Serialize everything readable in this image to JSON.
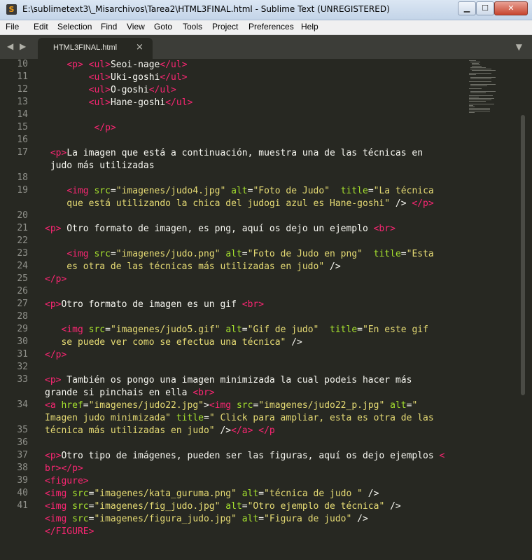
{
  "window": {
    "title": "E:\\sublimetext3\\_Misarchivos\\Tarea2\\HTML3FINAL.html - Sublime Text (UNREGISTERED)",
    "app_icon_letter": "S",
    "buttons": {
      "minimize": "▁",
      "maximize": "☐",
      "close": "✕"
    }
  },
  "menu": [
    "File",
    "Edit",
    "Selection",
    "Find",
    "View",
    "Goto",
    "Tools",
    "Project",
    "Preferences",
    "Help"
  ],
  "tabs": [
    {
      "label": "HTML3FINAL.html",
      "active": true,
      "close": "×"
    }
  ],
  "nav": {
    "back": "◀",
    "forward": "▶",
    "dropdown": "▼"
  },
  "line_numbers": [
    "10",
    "11",
    "12",
    "13",
    "14",
    "15",
    "16",
    "17",
    "18",
    "19",
    "20",
    "21",
    "22",
    "23",
    "24",
    "25",
    "26",
    "27",
    "28",
    "29",
    "30",
    "31",
    "32",
    "33",
    "34",
    "35",
    "36",
    "37",
    "38",
    "39",
    "40",
    "41"
  ],
  "code_lines": [
    [
      [
        "plain",
        "    "
      ],
      [
        "tag",
        "<p>"
      ],
      [
        "plain",
        " "
      ],
      [
        "tag",
        "<ul>"
      ],
      [
        "plain",
        "Seoi-nage"
      ],
      [
        "tag",
        "</ul>"
      ]
    ],
    [
      [
        "plain",
        "        "
      ],
      [
        "tag",
        "<ul>"
      ],
      [
        "plain",
        "Uki-goshi"
      ],
      [
        "tag",
        "</ul>"
      ]
    ],
    [
      [
        "plain",
        "        "
      ],
      [
        "tag",
        "<ul>"
      ],
      [
        "plain",
        "O-goshi"
      ],
      [
        "tag",
        "</ul>"
      ]
    ],
    [
      [
        "plain",
        "        "
      ],
      [
        "tag",
        "<ul>"
      ],
      [
        "plain",
        "Hane-goshi"
      ],
      [
        "tag",
        "</ul>"
      ]
    ],
    [],
    [
      [
        "plain",
        "         "
      ],
      [
        "tag",
        "</p>"
      ]
    ],
    [],
    [
      [
        "plain",
        " "
      ],
      [
        "tag",
        "<p>"
      ],
      [
        "plain",
        "La imagen que está a continuación, muestra una de las técnicas en"
      ]
    ],
    [
      [
        "plain",
        " judo más utilizadas"
      ]
    ],
    [],
    [
      [
        "plain",
        "    "
      ],
      [
        "tag",
        "<img"
      ],
      [
        "plain",
        " "
      ],
      [
        "attr",
        "src"
      ],
      [
        "plain",
        "="
      ],
      [
        "str",
        "\"imagenes/judo4.jpg\""
      ],
      [
        "plain",
        " "
      ],
      [
        "attr",
        "alt"
      ],
      [
        "plain",
        "="
      ],
      [
        "str",
        "\"Foto de Judo\""
      ],
      [
        "plain",
        "  "
      ],
      [
        "attr",
        "title"
      ],
      [
        "plain",
        "="
      ],
      [
        "str",
        "\"La técnica"
      ]
    ],
    [
      [
        "str",
        "    que está utilizando la chica del judogi azul es Hane-goshi\""
      ],
      [
        "plain",
        " /> "
      ],
      [
        "tag",
        "</p>"
      ]
    ],
    [],
    [
      [
        "tag",
        "<p>"
      ],
      [
        "plain",
        " Otro formato de imagen, es png, aquí os dejo un ejemplo "
      ],
      [
        "tag",
        "<br>"
      ]
    ],
    [],
    [
      [
        "plain",
        "    "
      ],
      [
        "tag",
        "<img"
      ],
      [
        "plain",
        " "
      ],
      [
        "attr",
        "src"
      ],
      [
        "plain",
        "="
      ],
      [
        "str",
        "\"imagenes/judo.png\""
      ],
      [
        "plain",
        " "
      ],
      [
        "attr",
        "alt"
      ],
      [
        "plain",
        "="
      ],
      [
        "str",
        "\"Foto de Judo en png\""
      ],
      [
        "plain",
        "  "
      ],
      [
        "attr",
        "title"
      ],
      [
        "plain",
        "="
      ],
      [
        "str",
        "\"Esta"
      ]
    ],
    [
      [
        "str",
        "    es otra de las técnicas más utilizadas en judo\""
      ],
      [
        "plain",
        " />"
      ]
    ],
    [
      [
        "tag",
        "</p>"
      ]
    ],
    [],
    [
      [
        "tag",
        "<p>"
      ],
      [
        "plain",
        "Otro formato de imagen es un gif "
      ],
      [
        "tag",
        "<br>"
      ]
    ],
    [],
    [
      [
        "plain",
        "   "
      ],
      [
        "tag",
        "<img"
      ],
      [
        "plain",
        " "
      ],
      [
        "attr",
        "src"
      ],
      [
        "plain",
        "="
      ],
      [
        "str",
        "\"imagenes/judo5.gif\""
      ],
      [
        "plain",
        " "
      ],
      [
        "attr",
        "alt"
      ],
      [
        "plain",
        "="
      ],
      [
        "str",
        "\"Gif de judo\""
      ],
      [
        "plain",
        "  "
      ],
      [
        "attr",
        "title"
      ],
      [
        "plain",
        "="
      ],
      [
        "str",
        "\"En este gif"
      ]
    ],
    [
      [
        "str",
        "   se puede ver como se efectua una técnica\""
      ],
      [
        "plain",
        " />"
      ]
    ],
    [
      [
        "tag",
        "</p>"
      ]
    ],
    [],
    [
      [
        "tag",
        "<p>"
      ],
      [
        "plain",
        " También os pongo una imagen minimizada la cual podeis hacer más"
      ]
    ],
    [
      [
        "plain",
        "grande si pinchais en ella "
      ],
      [
        "tag",
        "<br>"
      ]
    ],
    [
      [
        "tag",
        "<a"
      ],
      [
        "plain",
        " "
      ],
      [
        "attr",
        "href"
      ],
      [
        "plain",
        "="
      ],
      [
        "str",
        "\"imagenes/judo22.jpg\""
      ],
      [
        "plain",
        ">"
      ],
      [
        "tag",
        "<img"
      ],
      [
        "plain",
        " "
      ],
      [
        "attr",
        "src"
      ],
      [
        "plain",
        "="
      ],
      [
        "str",
        "\"imagenes/judo22_p.jpg\""
      ],
      [
        "plain",
        " "
      ],
      [
        "attr",
        "alt"
      ],
      [
        "plain",
        "="
      ],
      [
        "str",
        "\""
      ]
    ],
    [
      [
        "str",
        "Imagen judo minimizada\""
      ],
      [
        "plain",
        " "
      ],
      [
        "attr",
        "title"
      ],
      [
        "plain",
        "="
      ],
      [
        "str",
        "\" Click para ampliar, esta es otra de las"
      ]
    ],
    [
      [
        "str",
        "técnica más utilizadas en judo\""
      ],
      [
        "plain",
        " />"
      ],
      [
        "tag",
        "</a>"
      ],
      [
        "plain",
        " "
      ],
      [
        "tag",
        "</p"
      ]
    ],
    [],
    [
      [
        "tag",
        "<p>"
      ],
      [
        "plain",
        "Otro tipo de imágenes, pueden ser las figuras, aquí os dejo ejemplos "
      ],
      [
        "tag",
        "<"
      ]
    ],
    [
      [
        "tag",
        "br></p>"
      ]
    ],
    [
      [
        "tag",
        "<figure>"
      ]
    ],
    [
      [
        "tag",
        "<img"
      ],
      [
        "plain",
        " "
      ],
      [
        "attr",
        "src"
      ],
      [
        "plain",
        "="
      ],
      [
        "str",
        "\"imagenes/kata_guruma.png\""
      ],
      [
        "plain",
        " "
      ],
      [
        "attr",
        "alt"
      ],
      [
        "plain",
        "="
      ],
      [
        "str",
        "\"técnica de judo \""
      ],
      [
        "plain",
        " />"
      ]
    ],
    [
      [
        "tag",
        "<img"
      ],
      [
        "plain",
        " "
      ],
      [
        "attr",
        "src"
      ],
      [
        "plain",
        "="
      ],
      [
        "str",
        "\"imagenes/fig_judo.jpg\""
      ],
      [
        "plain",
        " "
      ],
      [
        "attr",
        "alt"
      ],
      [
        "plain",
        "="
      ],
      [
        "str",
        "\"Otro ejemplo de técnica\""
      ],
      [
        "plain",
        " />"
      ]
    ],
    [
      [
        "tag",
        "<img"
      ],
      [
        "plain",
        " "
      ],
      [
        "attr",
        "src"
      ],
      [
        "plain",
        "="
      ],
      [
        "str",
        "\"imagenes/figura_judo.jpg\""
      ],
      [
        "plain",
        " "
      ],
      [
        "attr",
        "alt"
      ],
      [
        "plain",
        "="
      ],
      [
        "str",
        "\"Figura de judo\""
      ],
      [
        "plain",
        " />"
      ]
    ],
    [
      [
        "tag",
        "</FIGURE>"
      ]
    ],
    [],
    []
  ],
  "colors": {
    "background": "#272822",
    "tag": "#f92672",
    "attribute": "#a6e22e",
    "string": "#e6db74",
    "text": "#f8f8f2",
    "line_number": "#8f908a"
  }
}
